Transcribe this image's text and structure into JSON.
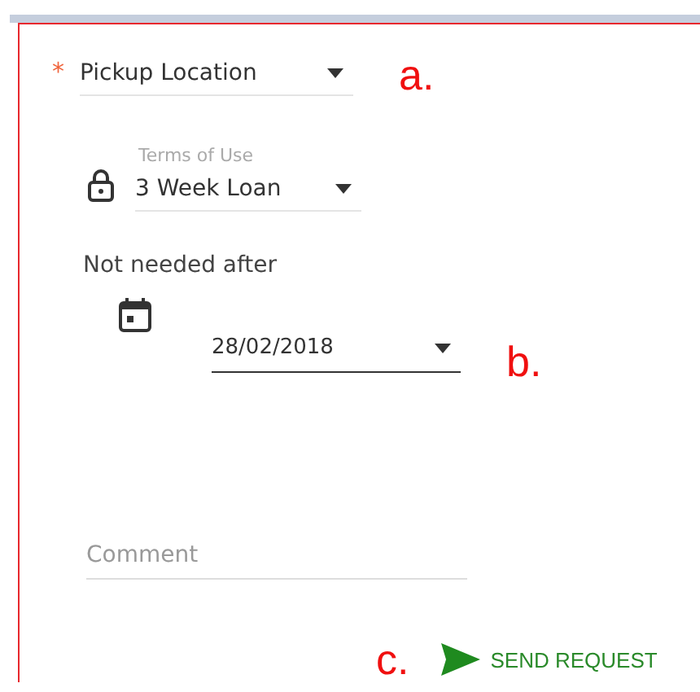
{
  "pickup": {
    "label": "Pickup Location",
    "required": true,
    "required_mark": "*",
    "annotation": "a."
  },
  "terms": {
    "caption": "Terms of Use",
    "value": "3 Week Loan",
    "locked": true
  },
  "not_needed_after": {
    "label": "Not needed after",
    "value": "28/02/2018",
    "annotation": "b."
  },
  "comment": {
    "placeholder": "Comment"
  },
  "send": {
    "label": "SEND REQUEST",
    "annotation": "c."
  }
}
